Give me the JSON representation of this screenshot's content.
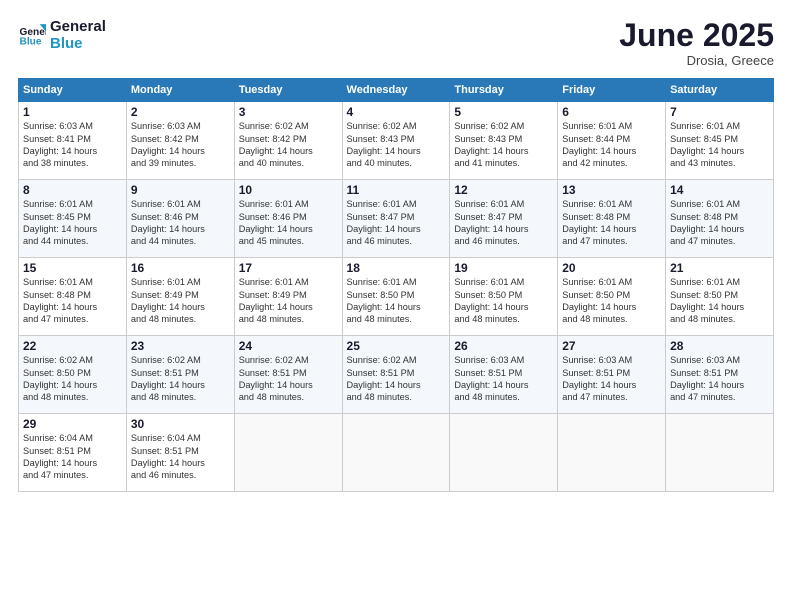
{
  "logo": {
    "line1": "General",
    "line2": "Blue"
  },
  "title": "June 2025",
  "subtitle": "Drosia, Greece",
  "days_header": [
    "Sunday",
    "Monday",
    "Tuesday",
    "Wednesday",
    "Thursday",
    "Friday",
    "Saturday"
  ],
  "weeks": [
    [
      {
        "day": "1",
        "info": "Sunrise: 6:03 AM\nSunset: 8:41 PM\nDaylight: 14 hours\nand 38 minutes."
      },
      {
        "day": "2",
        "info": "Sunrise: 6:03 AM\nSunset: 8:42 PM\nDaylight: 14 hours\nand 39 minutes."
      },
      {
        "day": "3",
        "info": "Sunrise: 6:02 AM\nSunset: 8:42 PM\nDaylight: 14 hours\nand 40 minutes."
      },
      {
        "day": "4",
        "info": "Sunrise: 6:02 AM\nSunset: 8:43 PM\nDaylight: 14 hours\nand 40 minutes."
      },
      {
        "day": "5",
        "info": "Sunrise: 6:02 AM\nSunset: 8:43 PM\nDaylight: 14 hours\nand 41 minutes."
      },
      {
        "day": "6",
        "info": "Sunrise: 6:01 AM\nSunset: 8:44 PM\nDaylight: 14 hours\nand 42 minutes."
      },
      {
        "day": "7",
        "info": "Sunrise: 6:01 AM\nSunset: 8:45 PM\nDaylight: 14 hours\nand 43 minutes."
      }
    ],
    [
      {
        "day": "8",
        "info": "Sunrise: 6:01 AM\nSunset: 8:45 PM\nDaylight: 14 hours\nand 44 minutes."
      },
      {
        "day": "9",
        "info": "Sunrise: 6:01 AM\nSunset: 8:46 PM\nDaylight: 14 hours\nand 44 minutes."
      },
      {
        "day": "10",
        "info": "Sunrise: 6:01 AM\nSunset: 8:46 PM\nDaylight: 14 hours\nand 45 minutes."
      },
      {
        "day": "11",
        "info": "Sunrise: 6:01 AM\nSunset: 8:47 PM\nDaylight: 14 hours\nand 46 minutes."
      },
      {
        "day": "12",
        "info": "Sunrise: 6:01 AM\nSunset: 8:47 PM\nDaylight: 14 hours\nand 46 minutes."
      },
      {
        "day": "13",
        "info": "Sunrise: 6:01 AM\nSunset: 8:48 PM\nDaylight: 14 hours\nand 47 minutes."
      },
      {
        "day": "14",
        "info": "Sunrise: 6:01 AM\nSunset: 8:48 PM\nDaylight: 14 hours\nand 47 minutes."
      }
    ],
    [
      {
        "day": "15",
        "info": "Sunrise: 6:01 AM\nSunset: 8:48 PM\nDaylight: 14 hours\nand 47 minutes."
      },
      {
        "day": "16",
        "info": "Sunrise: 6:01 AM\nSunset: 8:49 PM\nDaylight: 14 hours\nand 48 minutes."
      },
      {
        "day": "17",
        "info": "Sunrise: 6:01 AM\nSunset: 8:49 PM\nDaylight: 14 hours\nand 48 minutes."
      },
      {
        "day": "18",
        "info": "Sunrise: 6:01 AM\nSunset: 8:50 PM\nDaylight: 14 hours\nand 48 minutes."
      },
      {
        "day": "19",
        "info": "Sunrise: 6:01 AM\nSunset: 8:50 PM\nDaylight: 14 hours\nand 48 minutes."
      },
      {
        "day": "20",
        "info": "Sunrise: 6:01 AM\nSunset: 8:50 PM\nDaylight: 14 hours\nand 48 minutes."
      },
      {
        "day": "21",
        "info": "Sunrise: 6:01 AM\nSunset: 8:50 PM\nDaylight: 14 hours\nand 48 minutes."
      }
    ],
    [
      {
        "day": "22",
        "info": "Sunrise: 6:02 AM\nSunset: 8:50 PM\nDaylight: 14 hours\nand 48 minutes."
      },
      {
        "day": "23",
        "info": "Sunrise: 6:02 AM\nSunset: 8:51 PM\nDaylight: 14 hours\nand 48 minutes."
      },
      {
        "day": "24",
        "info": "Sunrise: 6:02 AM\nSunset: 8:51 PM\nDaylight: 14 hours\nand 48 minutes."
      },
      {
        "day": "25",
        "info": "Sunrise: 6:02 AM\nSunset: 8:51 PM\nDaylight: 14 hours\nand 48 minutes."
      },
      {
        "day": "26",
        "info": "Sunrise: 6:03 AM\nSunset: 8:51 PM\nDaylight: 14 hours\nand 48 minutes."
      },
      {
        "day": "27",
        "info": "Sunrise: 6:03 AM\nSunset: 8:51 PM\nDaylight: 14 hours\nand 47 minutes."
      },
      {
        "day": "28",
        "info": "Sunrise: 6:03 AM\nSunset: 8:51 PM\nDaylight: 14 hours\nand 47 minutes."
      }
    ],
    [
      {
        "day": "29",
        "info": "Sunrise: 6:04 AM\nSunset: 8:51 PM\nDaylight: 14 hours\nand 47 minutes."
      },
      {
        "day": "30",
        "info": "Sunrise: 6:04 AM\nSunset: 8:51 PM\nDaylight: 14 hours\nand 46 minutes."
      },
      {
        "day": "",
        "info": ""
      },
      {
        "day": "",
        "info": ""
      },
      {
        "day": "",
        "info": ""
      },
      {
        "day": "",
        "info": ""
      },
      {
        "day": "",
        "info": ""
      }
    ]
  ]
}
